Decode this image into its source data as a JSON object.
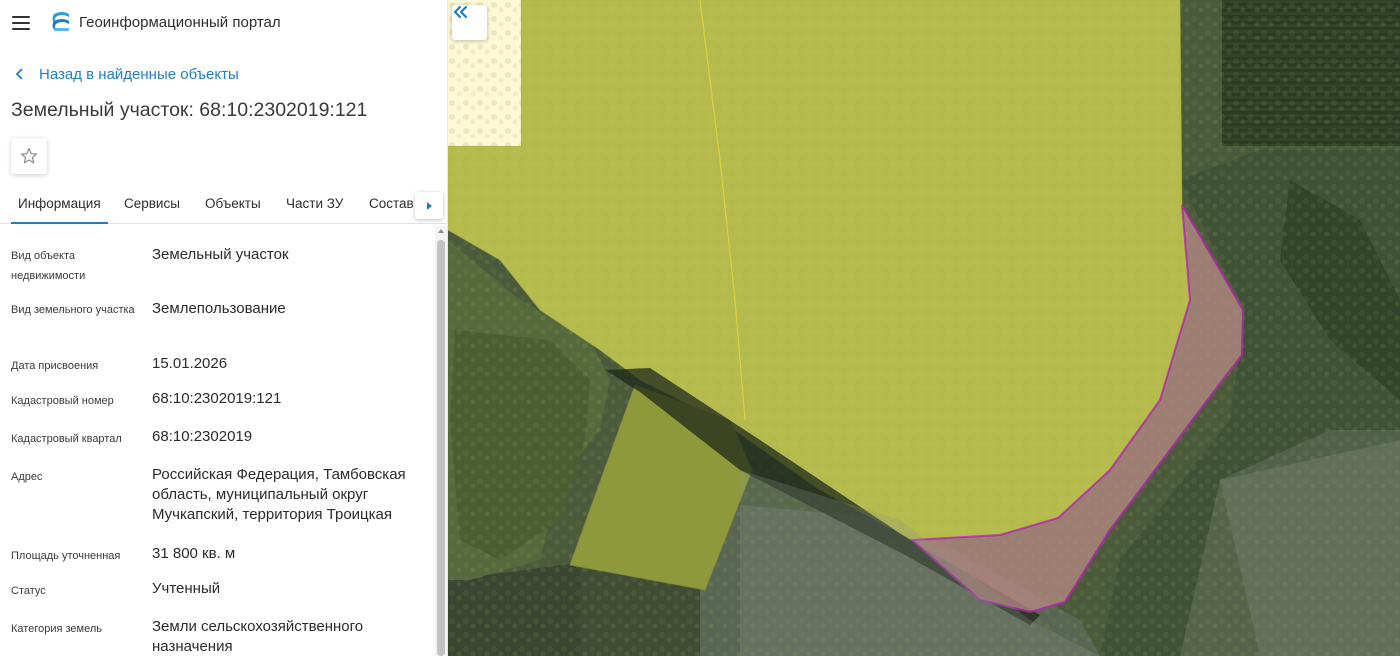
{
  "header": {
    "menu_icon": "hamburger-icon",
    "logo_icon": "portal-logo-icon",
    "title": "Геоинформационный портал"
  },
  "nav": {
    "back_label": "Назад в найденные объекты",
    "back_icon": "chevron-left-icon"
  },
  "object": {
    "title": "Земельный участок: 68:10:2302019:121",
    "favorite_icon": "star-outline-icon"
  },
  "tabs": {
    "items": [
      {
        "label": "Информация",
        "active": true
      },
      {
        "label": "Сервисы",
        "active": false
      },
      {
        "label": "Объекты",
        "active": false
      },
      {
        "label": "Части ЗУ",
        "active": false
      },
      {
        "label": "Состав",
        "active": false
      }
    ],
    "next_icon": "triangle-right-icon"
  },
  "info": {
    "rows": [
      {
        "label": "Вид объекта недвижимости",
        "value": "Земельный участок"
      },
      {
        "label": "Вид земельного участка",
        "value": "Землепользование"
      },
      {
        "label": "Дата присвоения",
        "value": "15.01.2026"
      },
      {
        "label": "Кадастровый номер",
        "value": "68:10:2302019:121"
      },
      {
        "label": "Кадастровый квартал",
        "value": "68:10:2302019"
      },
      {
        "label": "Адрес",
        "value": "Российская Федерация, Тамбовская область, муниципальный округ Мучкапский, территория Троицкая"
      },
      {
        "label": "Площадь уточненная",
        "value": "31 800 кв. м"
      },
      {
        "label": "Статус",
        "value": "Учтенный"
      },
      {
        "label": "Категория земель",
        "value": "Земли сельскохозяйственного назначения"
      }
    ]
  },
  "map": {
    "collapse_icon": "double-chevron-left-icon",
    "colors": {
      "selected_parcel_fill": "#b98a86",
      "selected_parcel_stroke": "#c020c0",
      "parcel_overlay": "#e8ea4a",
      "parcel_outline": "#e0d040",
      "accent": "#1f7fc4"
    }
  }
}
